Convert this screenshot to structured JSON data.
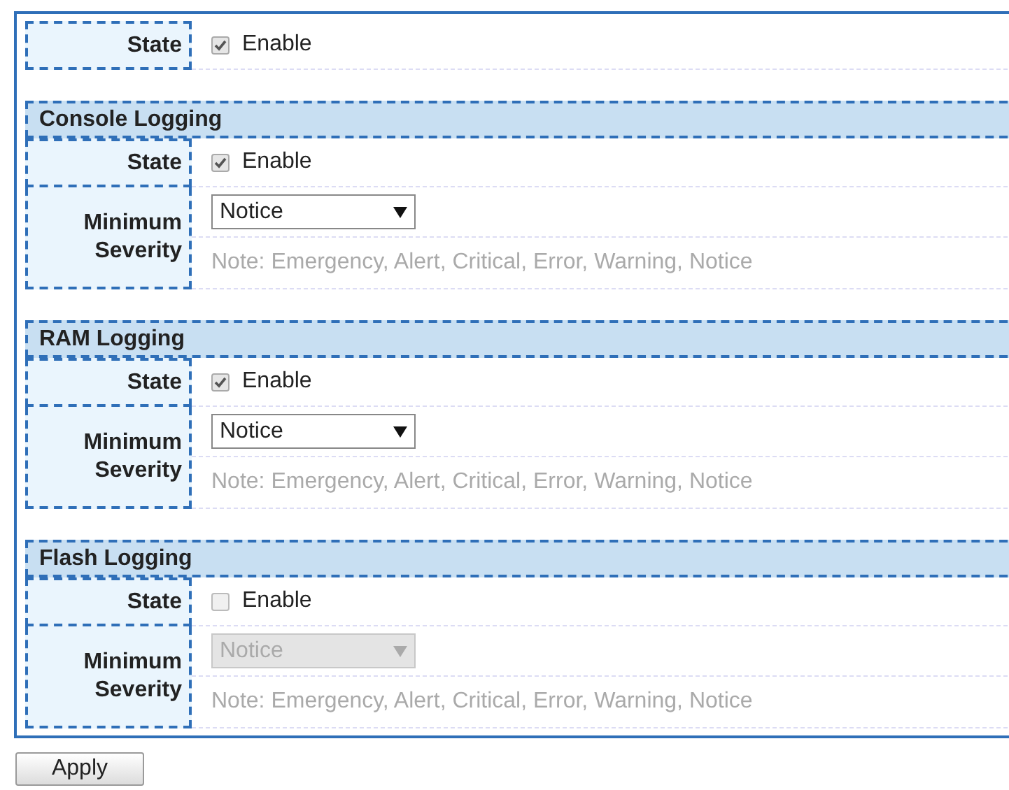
{
  "global_state": {
    "label": "State",
    "checked": true,
    "option": "Enable"
  },
  "sections": [
    {
      "title": "Console Logging",
      "state": {
        "label": "State",
        "checked": true,
        "option": "Enable"
      },
      "severity": {
        "label": "Minimum Severity",
        "value": "Notice",
        "disabled": false,
        "note": "Note: Emergency, Alert, Critical, Error, Warning, Notice"
      }
    },
    {
      "title": "RAM Logging",
      "state": {
        "label": "State",
        "checked": true,
        "option": "Enable"
      },
      "severity": {
        "label": "Minimum Severity",
        "value": "Notice",
        "disabled": false,
        "note": "Note: Emergency, Alert, Critical, Error, Warning, Notice"
      }
    },
    {
      "title": "Flash Logging",
      "state": {
        "label": "State",
        "checked": false,
        "option": "Enable"
      },
      "severity": {
        "label": "Minimum Severity",
        "value": "Notice",
        "disabled": true,
        "note": "Note: Emergency, Alert, Critical, Error, Warning, Notice"
      }
    }
  ],
  "apply_button": "Apply"
}
